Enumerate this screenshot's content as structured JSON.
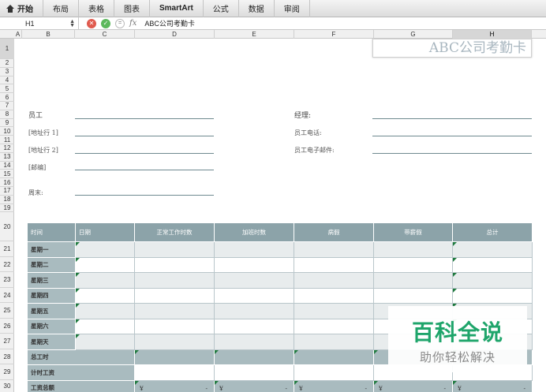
{
  "ribbon": {
    "tabs": [
      {
        "label": "开始"
      },
      {
        "label": "布局"
      },
      {
        "label": "表格"
      },
      {
        "label": "图表"
      },
      {
        "label": "SmartArt"
      },
      {
        "label": "公式"
      },
      {
        "label": "数据"
      },
      {
        "label": "审阅"
      }
    ]
  },
  "formula_bar": {
    "cell_ref": "H1",
    "fx_label": "fx",
    "value": "ABC公司考勤卡"
  },
  "columns": [
    "A",
    "B",
    "C",
    "D",
    "E",
    "F",
    "G",
    "H"
  ],
  "rows": [
    "1",
    "2",
    "3",
    "4",
    "5",
    "6",
    "7",
    "8",
    "9",
    "10",
    "11",
    "12",
    "13",
    "14",
    "15",
    "16",
    "17",
    "18",
    "19",
    "20",
    "21",
    "22",
    "23",
    "24",
    "25",
    "26",
    "27",
    "28",
    "29",
    "30"
  ],
  "sheet": {
    "title": "ABC公司考勤卡",
    "form": {
      "employee": "员工",
      "address1": "[地址行 1]",
      "address2": "[地址行 2]",
      "postcode": "[邮编]",
      "weekend": "周末:",
      "manager": "经理:",
      "phone": "员工电话:",
      "email": "员工电子邮件:"
    },
    "table": {
      "headers": [
        "时间",
        "日期",
        "正常工作时数",
        "加班时数",
        "病假",
        "带薪假",
        "总计"
      ],
      "days": [
        "星期一",
        "星期二",
        "星期三",
        "星期四",
        "星期五",
        "星期六",
        "星期天"
      ],
      "total_hours": "总工时",
      "hourly_wage": "计时工资",
      "total_wage": "工资总额",
      "currency": "¥",
      "dash": "-"
    }
  },
  "watermark": {
    "line1": "百科全说",
    "line2": "助你轻松解决"
  }
}
